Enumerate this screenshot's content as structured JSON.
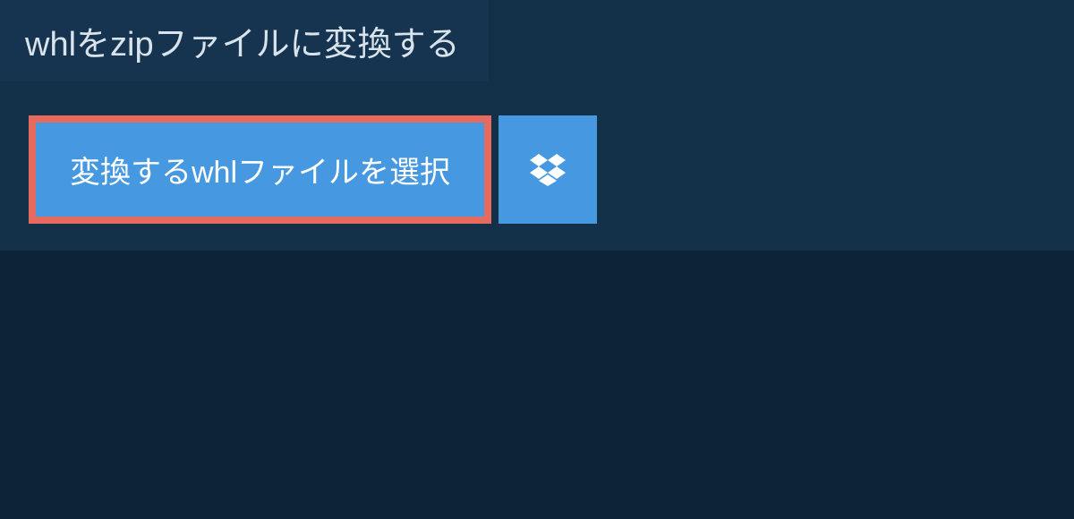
{
  "title": "whlをzipファイルに変換する",
  "select_button_label": "変換するwhlファイルを選択",
  "colors": {
    "background": "#0d2438",
    "panel": "#133049",
    "title_bg": "#163450",
    "button_bg": "#4698e0",
    "button_border": "#e76a5f",
    "text_light": "#d8e3ec",
    "text_white": "#ffffff"
  }
}
